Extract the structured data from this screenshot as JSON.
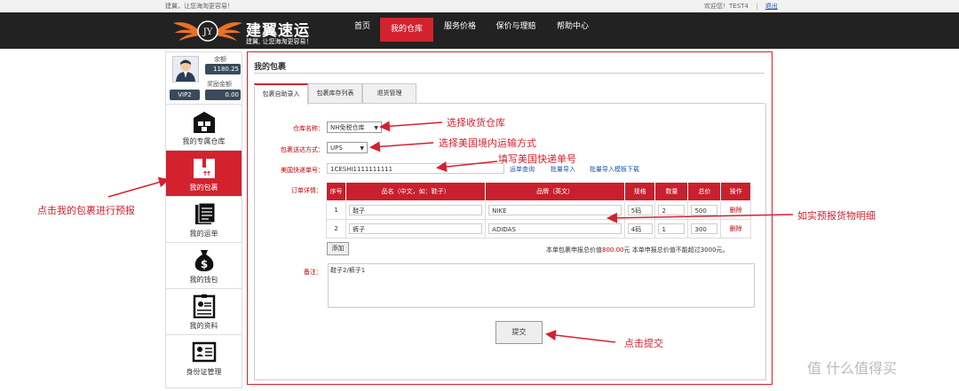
{
  "topbar": {
    "slogan": "建翼，让您海淘更容易！",
    "welcome": "欢迎您！TEST4",
    "logout": "退出"
  },
  "logo": {
    "badge": "JY",
    "name": "建翼速运",
    "tagline": "建翼, 让您海淘更容易！"
  },
  "nav": {
    "items": [
      {
        "label": "首页"
      },
      {
        "label": "我的仓库"
      },
      {
        "label": "服务价格"
      },
      {
        "label": "保价与理赔"
      },
      {
        "label": "帮助中心"
      }
    ]
  },
  "account": {
    "balance_label": "余额",
    "balance": "1180.25",
    "bonus_label": "奖励金额",
    "bonus": "0.00",
    "vip": "VIP2"
  },
  "sidebar": {
    "items": [
      {
        "label": "我的专属仓库",
        "icon": "warehouse-icon"
      },
      {
        "label": "我的包裹",
        "icon": "package-icon"
      },
      {
        "label": "我的运单",
        "icon": "waybill-icon"
      },
      {
        "label": "我的钱包",
        "icon": "money-bag-icon"
      },
      {
        "label": "我的资料",
        "icon": "profile-card-icon"
      },
      {
        "label": "身份证管理",
        "icon": "id-card-icon"
      }
    ]
  },
  "main": {
    "title": "我的包裹",
    "tabs": [
      {
        "label": "包裹自助录入"
      },
      {
        "label": "包裹库存列表"
      },
      {
        "label": "退货管理"
      }
    ],
    "form": {
      "warehouse_label": "仓库名称：",
      "warehouse_value": "NH免税仓库",
      "shipping_label": "包裹送达方式：",
      "shipping_value": "UPS",
      "tracking_label": "美国快递单号：",
      "tracking_value": "1CESHI1111111111",
      "links": [
        "运单查询",
        "批量导入",
        "批量导入模板下载"
      ],
      "details_label": "订单详情：",
      "columns": [
        "序号",
        "品名（中文，如：鞋子）",
        "品牌（英文）",
        "规格",
        "数量",
        "总价",
        "操作"
      ],
      "rows": [
        [
          "1",
          "鞋子",
          "NIKE",
          "5码",
          "2",
          "500",
          "删除"
        ],
        [
          "2",
          "裤子",
          "ADIDAS",
          "4码",
          "1",
          "300",
          "删除"
        ]
      ],
      "add_label": "添加",
      "total_prefix": "本单包裹申报总价值",
      "total_amount": "800.00",
      "total_suffix": "元  本单申报总价值不能超过3000元。",
      "remark_label": "备注：",
      "remark_value": "鞋子2/裤子1",
      "submit_label": "提交"
    }
  },
  "annotations": {
    "select_warehouse": "选择收货仓库",
    "select_shipping": "选择美国境内运输方式",
    "fill_tracking": "填写美国快递单号",
    "click_package": "点击我的包裹进行预报",
    "declare_items": "如实预报货物明细",
    "click_submit": "点击提交"
  },
  "watermark": "值 什么值得买"
}
